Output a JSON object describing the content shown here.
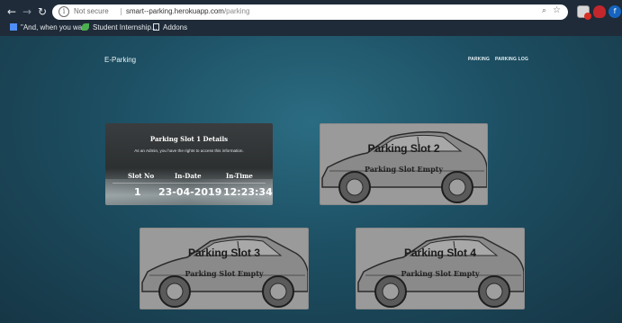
{
  "browser": {
    "security_label": "Not secure",
    "url_host": "smart--parking.herokuapp.com",
    "url_path": "/parking",
    "bookmarks": [
      {
        "label": "\"And, when you wa...",
        "icon": "apps-icon"
      },
      {
        "label": "Student Internship...",
        "icon": "leaf-icon"
      },
      {
        "label": "Addons",
        "icon": "doc-icon"
      }
    ],
    "extension_badge_color": "#d93025"
  },
  "header": {
    "brand": "E-Parking",
    "nav": [
      "PARKING",
      "PARKING LOG"
    ]
  },
  "slot1": {
    "title": "Parking Slot 1 Details",
    "subtitle": "As an Admin, you have the rights to access this information.",
    "columns": [
      "Slot No",
      "In-Date",
      "In-Time"
    ],
    "values": [
      "1",
      "23-04-2019",
      "12:23:34"
    ]
  },
  "slots": [
    {
      "title": "Parking Slot 2",
      "status": "Parking Slot Empty"
    },
    {
      "title": "Parking Slot 3",
      "status": "Parking Slot Empty"
    },
    {
      "title": "Parking Slot 4",
      "status": "Parking Slot Empty"
    }
  ],
  "colors": {
    "page_bg": "#1d4f63",
    "card_bg": "#9a9a9a",
    "chrome_bg": "#1f2b38"
  }
}
